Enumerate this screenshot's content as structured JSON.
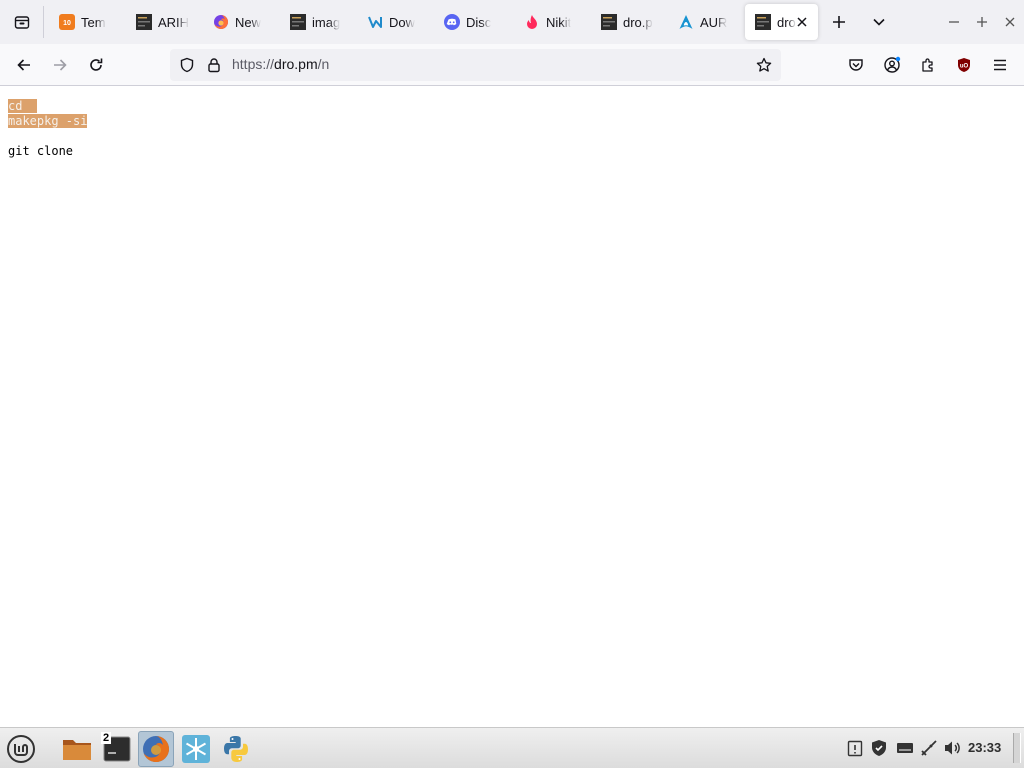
{
  "tabs": [
    {
      "title": "Temp Mail",
      "icon": "temp-mail-icon"
    },
    {
      "title": "ARIHANT",
      "icon": "terminal-page-icon"
    },
    {
      "title": "New Tab",
      "icon": "firefox-icon"
    },
    {
      "title": "image",
      "icon": "terminal-page-icon"
    },
    {
      "title": "Download",
      "icon": "vs-code-icon"
    },
    {
      "title": "Discord",
      "icon": "discord-icon"
    },
    {
      "title": "Nikita",
      "icon": "tinder-flame-icon"
    },
    {
      "title": "dro.pm",
      "icon": "terminal-page-icon"
    },
    {
      "title": "AUR",
      "icon": "arch-linux-icon"
    },
    {
      "title": "dro.pm",
      "icon": "terminal-page-icon",
      "active": true
    }
  ],
  "tab_titles_visible": [
    "Tem",
    "ARIH",
    "New",
    "imag",
    "Dow",
    "Disc",
    "Nikit",
    "dro.p",
    "AUR",
    "dro"
  ],
  "url": {
    "scheme": "https://",
    "host": "dro.pm",
    "path": "/n"
  },
  "page": {
    "lines_selected": [
      "cd",
      "makepkg -si"
    ],
    "line_plain": "git clone"
  },
  "taskbar": {
    "terminal_badge": "2",
    "clock": "23:33"
  },
  "colors": {
    "selection": "#dca16b",
    "tabbar_bg": "#f0f0f4",
    "navbar_bg": "#f9f9fb",
    "ublock_red": "#800000"
  }
}
